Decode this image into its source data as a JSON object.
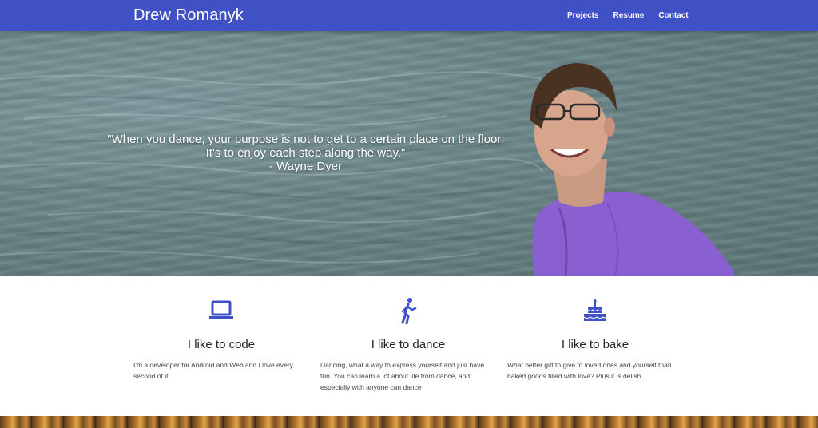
{
  "nav": {
    "brand": "Drew Romanyk",
    "links": [
      "Projects",
      "Resume",
      "Contact"
    ]
  },
  "hero": {
    "quote_line1": "\"When you dance, your purpose is not to get to a certain place on the floor.",
    "quote_line2": "It's to enjoy each step along the way.\"",
    "quote_author": "- Wayne Dyer"
  },
  "features": [
    {
      "icon": "laptop-icon",
      "title": "I like to code",
      "text": "I'm a developer for Android and Web and I love every second of it!"
    },
    {
      "icon": "walking-person-icon",
      "title": "I like to dance",
      "text": "Dancing, what a way to express yourself and just have fun. You can learn a lot about life from dance, and especially with anyone can dance"
    },
    {
      "icon": "cake-icon",
      "title": "I like to bake",
      "text": "What better gift to give to loved ones and yourself than baked goods filled with love? Plus it is delish."
    }
  ],
  "colors": {
    "primary": "#3f51c4",
    "icon": "#3f51c4",
    "water": "#6a8588",
    "shirt": "#8a5fcf"
  }
}
